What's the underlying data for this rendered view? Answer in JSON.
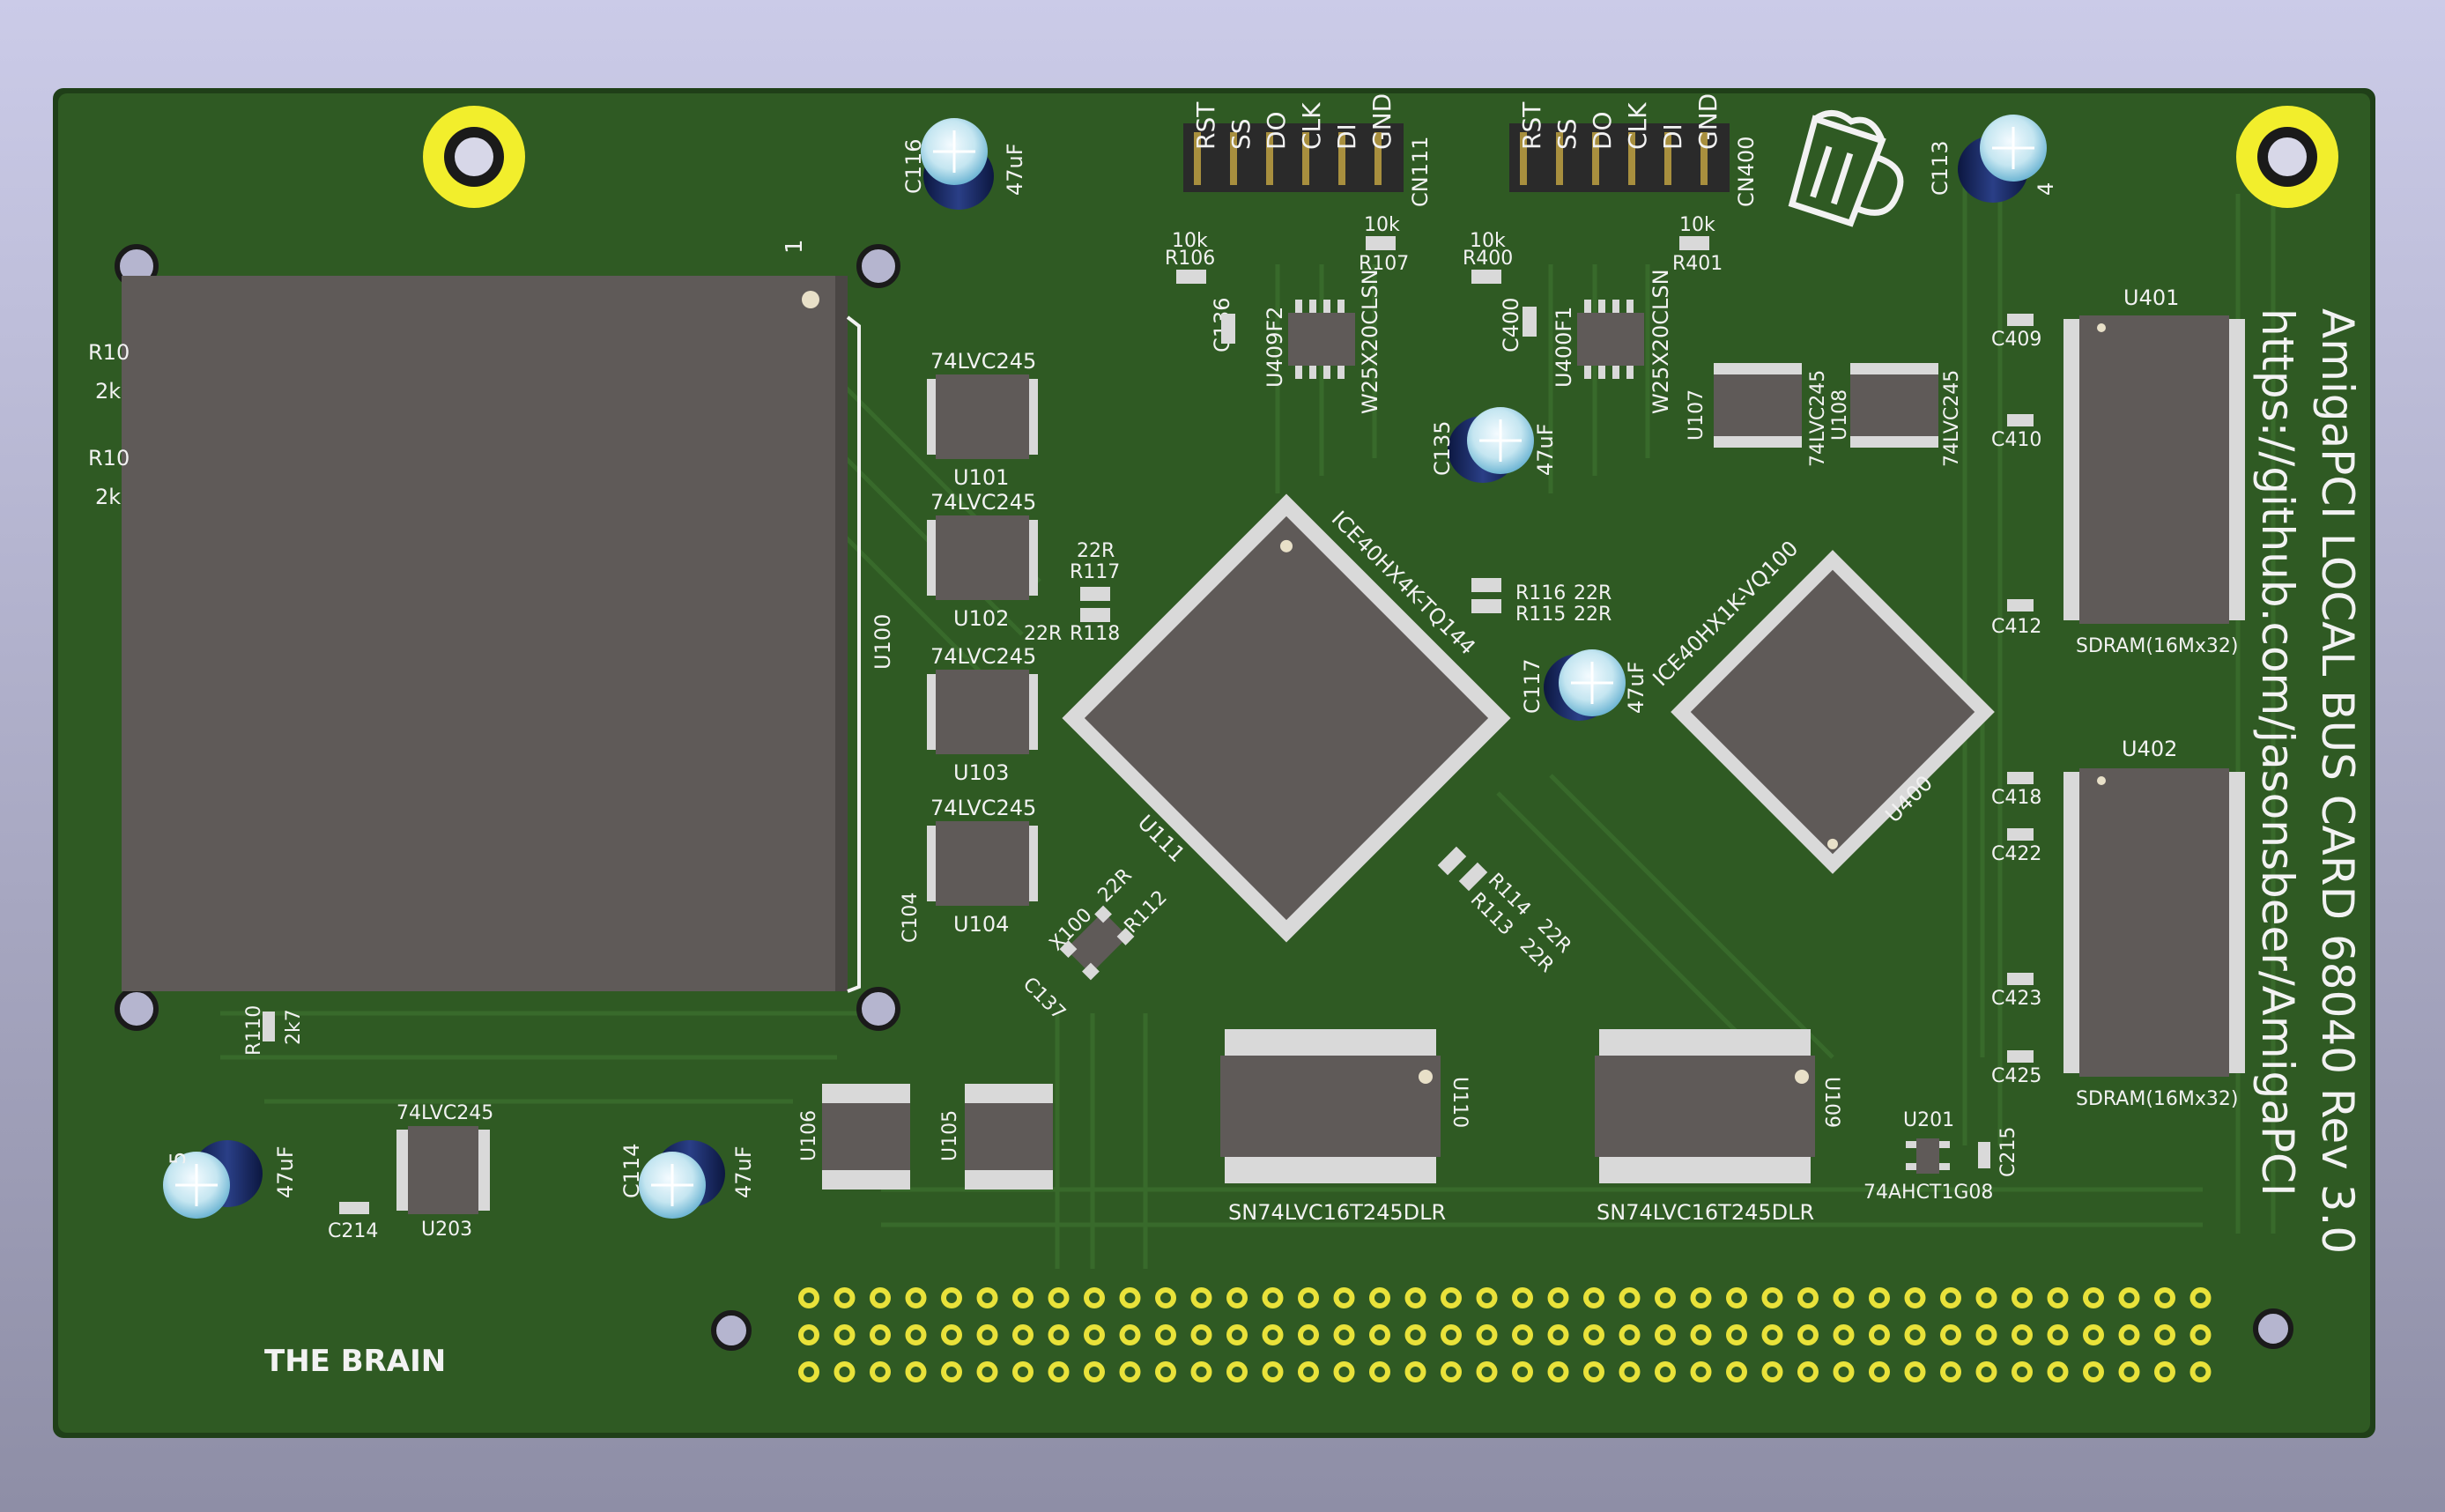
{
  "colors": {
    "background_top": "#c9c9e6",
    "background_bottom": "#8f8fa8",
    "board": "#2f5a23",
    "board_edge": "#1f3f18",
    "ic_body": "#5f5a58",
    "silkscreen": "#f2f2f2",
    "pad_gold": "#e9e23a",
    "capacitor_top": "#bfe2ee",
    "capacitor_body": "#1b2d6b"
  },
  "board": {
    "title_line1": "AmigaPCI LOCAL BUS CARD 68040 Rev 3.0",
    "title_line2": "https://github.com/jasonsbeer/AmigaPCI",
    "name_label": "THE BRAIN",
    "pin1_marker": "1"
  },
  "connectors": {
    "cn111": {
      "ref": "CN111",
      "pins": [
        "RST",
        "SS",
        "DO",
        "CLK",
        "DI",
        "GND"
      ]
    },
    "cn400": {
      "ref": "CN400",
      "pins": [
        "RST",
        "SS",
        "DO",
        "CLK",
        "DI",
        "GND"
      ]
    }
  },
  "ics": {
    "u100": {
      "ref": "U100"
    },
    "u101": {
      "ref": "U101",
      "value": "74LVC245"
    },
    "u102": {
      "ref": "U102",
      "value": "74LVC245"
    },
    "u103": {
      "ref": "U103",
      "value": "74LVC245"
    },
    "u104": {
      "ref": "U104",
      "value": "74LVC245"
    },
    "u105": {
      "ref": "U105"
    },
    "u106": {
      "ref": "U106"
    },
    "u107": {
      "ref": "U107",
      "value": "74LVC245"
    },
    "u108": {
      "ref": "U108",
      "value": "74LVC245"
    },
    "u109": {
      "ref": "U109",
      "value": "SN74LVC16T245DLR"
    },
    "u110": {
      "ref": "U110",
      "value": "SN74LVC16T245DLR"
    },
    "u111": {
      "ref": "U111",
      "value": "ICE40HX4K-TQ144"
    },
    "u400": {
      "ref": "U400",
      "value": "ICE40HX1K-VQ100"
    },
    "u401": {
      "ref": "U401",
      "value": "SDRAM(16Mx32)"
    },
    "u402": {
      "ref": "U402",
      "value": "SDRAM(16Mx32)"
    },
    "u409": {
      "ref": "U409F2",
      "value": "W25X20CLSN"
    },
    "u400f": {
      "ref": "U400F1",
      "value": "W25X20CLSN"
    },
    "u201": {
      "ref": "U201",
      "value": "74AHCT1G08"
    },
    "u203": {
      "ref": "U203",
      "value": "74LVC245"
    }
  },
  "caps": {
    "c116": {
      "ref": "C116",
      "value": "47uF"
    },
    "c113": {
      "ref": "C113",
      "value": "4"
    },
    "c135": {
      "ref": "C135",
      "value": "47uF"
    },
    "c117": {
      "ref": "C117",
      "value": "47uF"
    },
    "c114": {
      "ref": "C114",
      "value": "47uF"
    },
    "c5": {
      "ref": "5",
      "value": "47uF"
    },
    "c136": {
      "ref": "C136"
    },
    "c400": {
      "ref": "C400"
    },
    "c104": {
      "ref": "C104"
    },
    "c137": {
      "ref": "C137"
    },
    "c214": {
      "ref": "C214"
    },
    "c215": {
      "ref": "C215"
    },
    "c409": {
      "ref": "C409"
    },
    "c410": {
      "ref": "C410"
    },
    "c412": {
      "ref": "C412"
    },
    "c418": {
      "ref": "C418"
    },
    "c422": {
      "ref": "C422"
    },
    "c423": {
      "ref": "C423"
    },
    "c425": {
      "ref": "C425"
    }
  },
  "resistors": {
    "r106": {
      "ref": "R106",
      "value": "10k"
    },
    "r107": {
      "ref": "R107",
      "value": "10k"
    },
    "r400": {
      "ref": "R400",
      "value": "10k"
    },
    "r401": {
      "ref": "R401",
      "value": "10k"
    },
    "r117": {
      "ref": "R117",
      "value": "22R"
    },
    "r118": {
      "ref": "R118",
      "value": "22R"
    },
    "r115": {
      "ref": "R115",
      "value": "22R"
    },
    "r116": {
      "ref": "R116",
      "value": "22R"
    },
    "r114": {
      "ref": "R114",
      "value": "22R"
    },
    "r113": {
      "ref": "R113",
      "value": "22R"
    },
    "r112": {
      "ref": "R112",
      "value": "22R"
    },
    "r110": {
      "ref": "R110",
      "value": "2k7"
    },
    "r10a": {
      "ref": "R10",
      "value": "2k"
    },
    "r10b": {
      "ref": "R10",
      "value": "2k"
    }
  },
  "crystal": {
    "ref": "X100"
  }
}
